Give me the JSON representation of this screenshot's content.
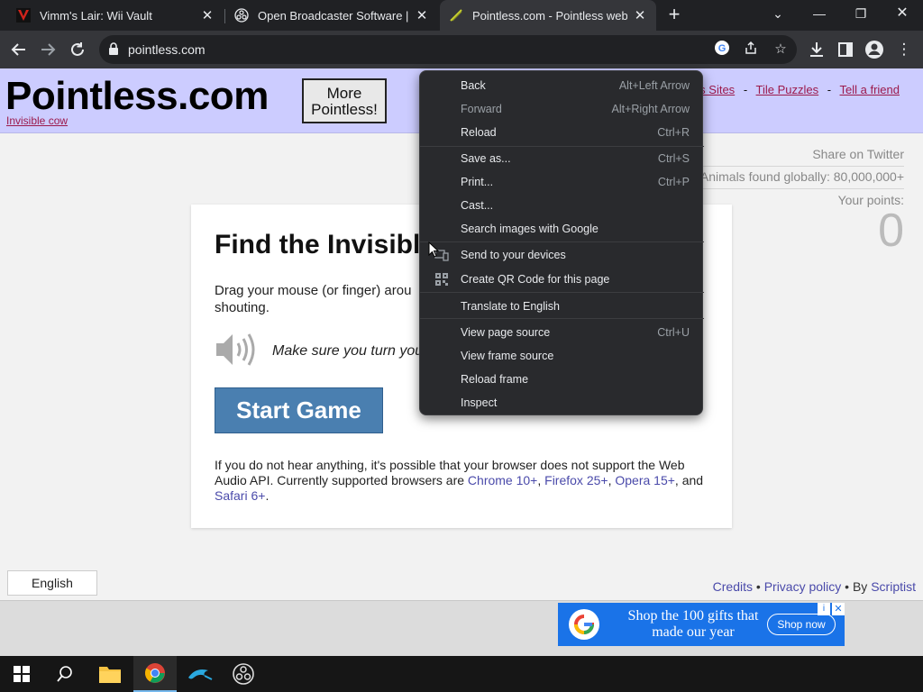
{
  "tabs": [
    {
      "title": "Vimm's Lair: Wii Vault",
      "icon": "vimm-icon"
    },
    {
      "title": "Open Broadcaster Software | OB",
      "icon": "obs-icon"
    },
    {
      "title": "Pointless.com - Pointless websit",
      "icon": "pointless-icon"
    }
  ],
  "address": {
    "url": "pointless.com"
  },
  "site": {
    "title": "Pointless.com",
    "subtitle": "Invisible cow",
    "more_button": "More Pointless!",
    "links": [
      "ss Sites",
      "Tile Puzzles",
      "Tell a friend"
    ],
    "link_sep": "-"
  },
  "sidebar": {
    "share": "Share on Twitter",
    "animals": "Animals found globally: 80,000,000+",
    "points_label": "Your points:",
    "points_value": "0"
  },
  "card": {
    "heading": "Find the Invisibl",
    "desc": "Drag your mouse (or finger) arou",
    "desc2": "shouting.",
    "note": "Make sure you turn you",
    "start_button": "Start Game",
    "footer_prefix": "If you do not hear anything, it's possible that your browser does not support the Web Audio API. Currently supported browsers are ",
    "browsers": [
      "Chrome 10+",
      "Firefox 25+",
      "Opera 15+",
      "Safari 6+"
    ],
    "footer_and": ", and",
    "footer_comma": ", ",
    "footer_end": "."
  },
  "footer": {
    "language": "English",
    "credits": "Credits",
    "privacy": "Privacy policy",
    "by": "By",
    "author": "Scriptist",
    "bullet": "•"
  },
  "ad": {
    "text": "Shop the 100 gifts that made our year",
    "button": "Shop now",
    "info": "i",
    "close": "✕"
  },
  "context_menu": {
    "items": [
      {
        "label": "Back",
        "shortcut": "Alt+Left Arrow"
      },
      {
        "label": "Forward",
        "shortcut": "Alt+Right Arrow"
      },
      {
        "label": "Reload",
        "shortcut": "Ctrl+R"
      },
      {
        "label": "Save as...",
        "shortcut": "Ctrl+S"
      },
      {
        "label": "Print...",
        "shortcut": "Ctrl+P"
      },
      {
        "label": "Cast...",
        "shortcut": ""
      },
      {
        "label": "Search images with Google",
        "shortcut": ""
      },
      {
        "label": "Send to your devices",
        "shortcut": ""
      },
      {
        "label": "Create QR Code for this page",
        "shortcut": ""
      },
      {
        "label": "Translate to English",
        "shortcut": ""
      },
      {
        "label": "View page source",
        "shortcut": "Ctrl+U"
      },
      {
        "label": "View frame source",
        "shortcut": ""
      },
      {
        "label": "Reload frame",
        "shortcut": ""
      },
      {
        "label": "Inspect",
        "shortcut": ""
      }
    ]
  },
  "colors": {
    "banner": "#ccccff",
    "start_button": "#4a7fb0",
    "link": "#9c1a4c",
    "menu_bg": "#292a2d",
    "ad_blue": "#1a73e8"
  }
}
